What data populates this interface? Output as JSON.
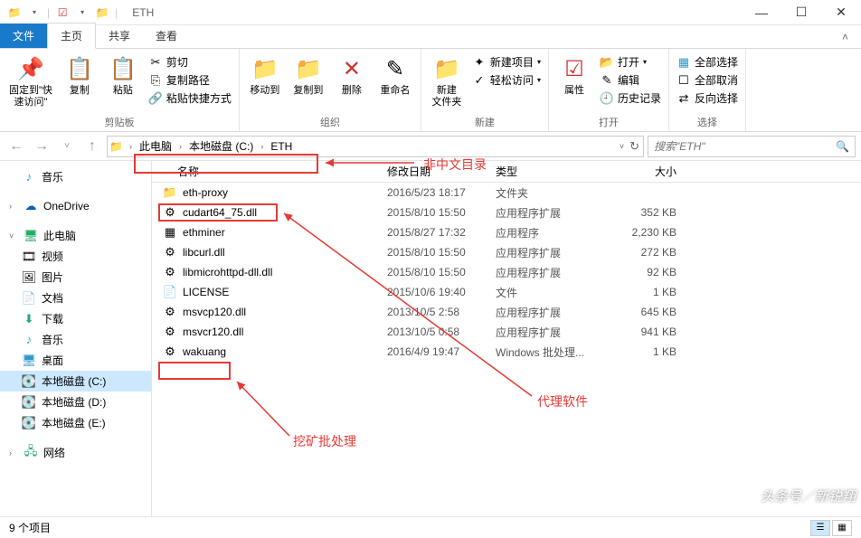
{
  "window": {
    "title": "ETH"
  },
  "winControls": {
    "min": "—",
    "max": "☐",
    "close": "✕"
  },
  "tabs": {
    "file": "文件",
    "home": "主页",
    "share": "共享",
    "view": "查看"
  },
  "ribbon": {
    "clipboard": {
      "pin": "固定到\"快\n速访问\"",
      "copy": "复制",
      "paste": "粘贴",
      "cut": "剪切",
      "copyPath": "复制路径",
      "pasteShortcut": "粘贴快捷方式",
      "label": "剪贴板"
    },
    "organize": {
      "moveTo": "移动到",
      "copyTo": "复制到",
      "delete": "删除",
      "rename": "重命名",
      "label": "组织"
    },
    "new": {
      "newFolder": "新建\n文件夹",
      "newItem": "新建项目",
      "easyAccess": "轻松访问",
      "label": "新建"
    },
    "open": {
      "properties": "属性",
      "open": "打开",
      "edit": "编辑",
      "history": "历史记录",
      "label": "打开"
    },
    "select": {
      "selectAll": "全部选择",
      "selectNone": "全部取消",
      "invert": "反向选择",
      "label": "选择"
    }
  },
  "breadcrumb": {
    "seg1": "此电脑",
    "seg2": "本地磁盘 (C:)",
    "seg3": "ETH"
  },
  "search": {
    "placeholder": "搜索\"ETH\"",
    "refresh": "↻"
  },
  "sidebar": {
    "music": "音乐",
    "onedrive": "OneDrive",
    "thispc": "此电脑",
    "videos": "视频",
    "pictures": "图片",
    "documents": "文档",
    "downloads": "下载",
    "music2": "音乐",
    "desktop": "桌面",
    "diskC": "本地磁盘 (C:)",
    "diskD": "本地磁盘 (D:)",
    "diskE": "本地磁盘 (E:)",
    "network": "网络"
  },
  "columns": {
    "name": "名称",
    "date": "修改日期",
    "type": "类型",
    "size": "大小"
  },
  "files": [
    {
      "icon": "📁",
      "name": "eth-proxy",
      "date": "2016/5/23 18:17",
      "type": "文件夹",
      "size": ""
    },
    {
      "icon": "⚙",
      "name": "cudart64_75.dll",
      "date": "2015/8/10 15:50",
      "type": "应用程序扩展",
      "size": "352 KB"
    },
    {
      "icon": "▦",
      "name": "ethminer",
      "date": "2015/8/27 17:32",
      "type": "应用程序",
      "size": "2,230 KB"
    },
    {
      "icon": "⚙",
      "name": "libcurl.dll",
      "date": "2015/8/10 15:50",
      "type": "应用程序扩展",
      "size": "272 KB"
    },
    {
      "icon": "⚙",
      "name": "libmicrohttpd-dll.dll",
      "date": "2015/8/10 15:50",
      "type": "应用程序扩展",
      "size": "92 KB"
    },
    {
      "icon": "📄",
      "name": "LICENSE",
      "date": "2015/10/6 19:40",
      "type": "文件",
      "size": "1 KB"
    },
    {
      "icon": "⚙",
      "name": "msvcp120.dll",
      "date": "2013/10/5 2:58",
      "type": "应用程序扩展",
      "size": "645 KB"
    },
    {
      "icon": "⚙",
      "name": "msvcr120.dll",
      "date": "2013/10/5 0:58",
      "type": "应用程序扩展",
      "size": "941 KB"
    },
    {
      "icon": "⚙",
      "name": "wakuang",
      "date": "2016/4/9 19:47",
      "type": "Windows 批处理...",
      "size": "1 KB"
    }
  ],
  "status": {
    "count": "9 个项目"
  },
  "annotations": {
    "nonChinese": "非中文目录",
    "proxy": "代理软件",
    "mining": "挖矿批处理"
  },
  "watermark": "头条号／新锐翔"
}
